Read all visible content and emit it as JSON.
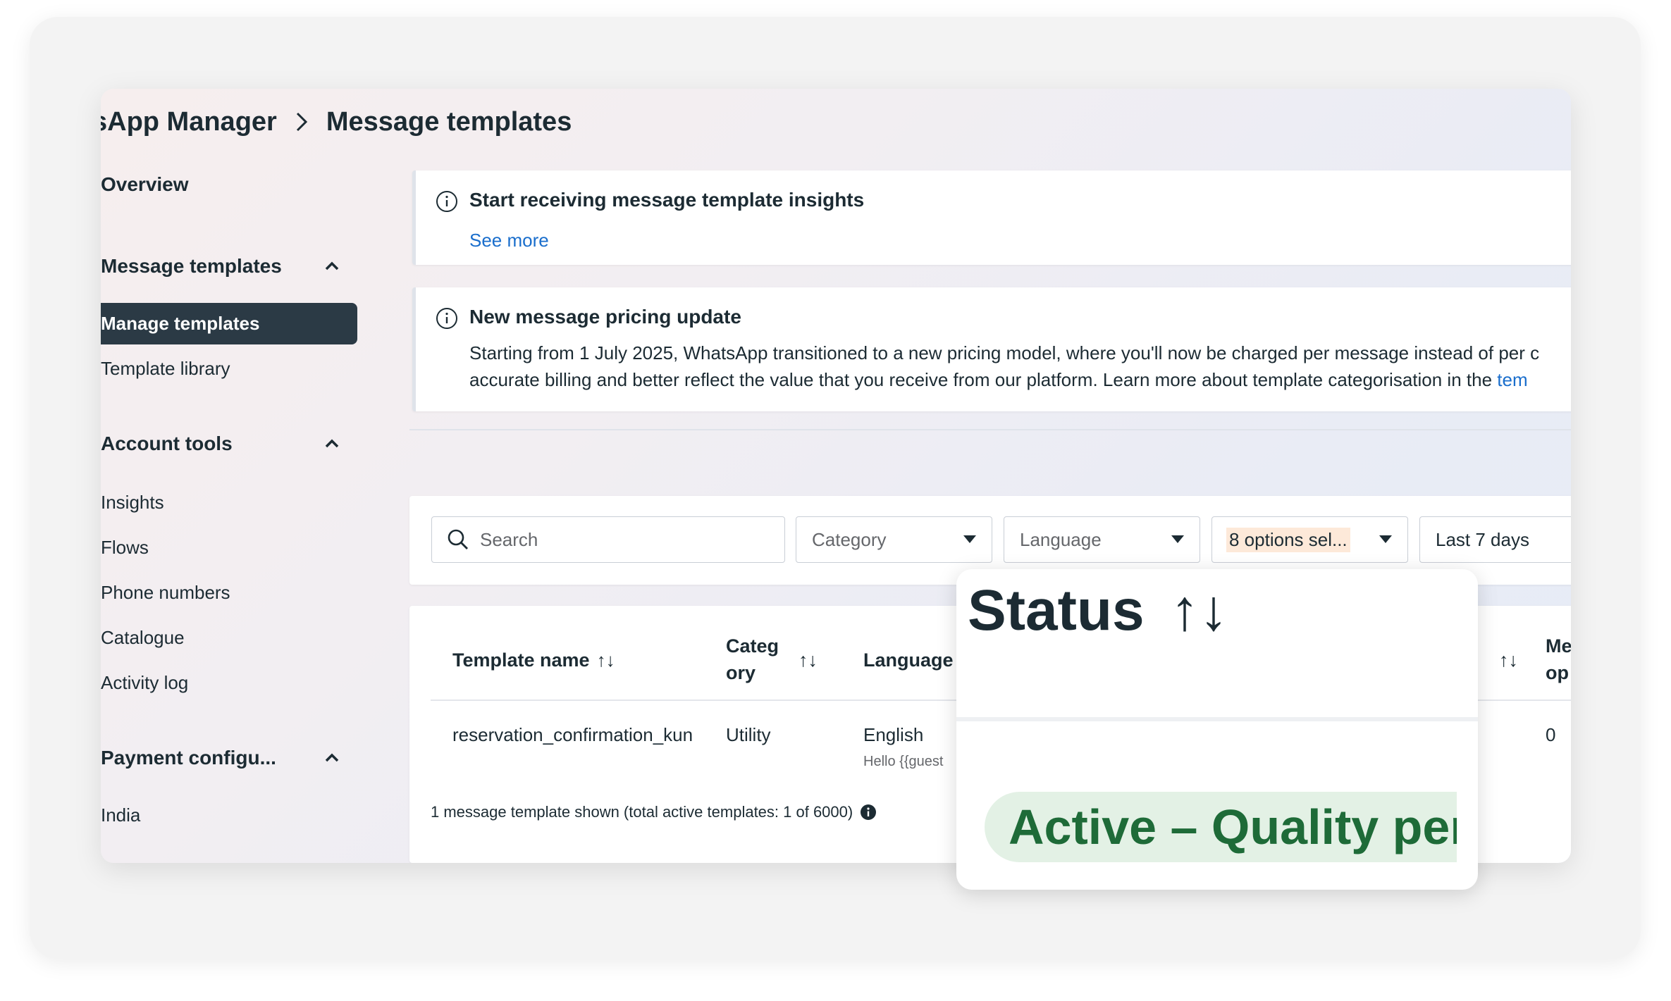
{
  "breadcrumb": {
    "parent": "sApp Manager",
    "current": "Message templates"
  },
  "sidebar": {
    "overview": "Overview",
    "message_templates": {
      "title": "Message templates",
      "items": [
        "Manage templates",
        "Template library"
      ]
    },
    "account_tools": {
      "title": "Account tools",
      "items": [
        "Insights",
        "Flows",
        "Phone numbers",
        "Catalogue",
        "Activity log"
      ]
    },
    "payment": {
      "title": "Payment configu...",
      "items": [
        "India"
      ]
    }
  },
  "banners": [
    {
      "title": "Start receiving message template insights",
      "link": "See more"
    },
    {
      "title": "New message pricing update",
      "line1": "Starting from 1 July 2025, WhatsApp transitioned to a new pricing model, where you'll now be charged per message instead of per c",
      "line2": "accurate billing and better reflect the value that you receive from our platform. Learn more about template categorisation in the",
      "link": "tem"
    }
  ],
  "filters": {
    "search_placeholder": "Search",
    "category": "Category",
    "language": "Language",
    "status": "8 options sel...",
    "date_range": "Last 7 days"
  },
  "table": {
    "headers": {
      "template_name": "Template name",
      "category_1": "Categ",
      "category_2": "ory",
      "language": "Language",
      "messages_1": "Me",
      "messages_2": "op",
      "sort": "↑↓"
    },
    "rows": [
      {
        "name": "reservation_confirmation_kun",
        "category": "Utility",
        "language": "English",
        "preview": "Hello {{guest",
        "messages": "0"
      }
    ],
    "footer": "1 message template shown (total active templates: 1 of 6000)"
  },
  "zoom": {
    "header": "Status",
    "sort": "↑↓",
    "status_badge": "Active – Quality pend"
  },
  "colors": {
    "active_nav": "#2b3a45",
    "link": "#1a6ecc",
    "badge_bg": "#e3f1e5",
    "badge_text": "#1e6b38"
  }
}
